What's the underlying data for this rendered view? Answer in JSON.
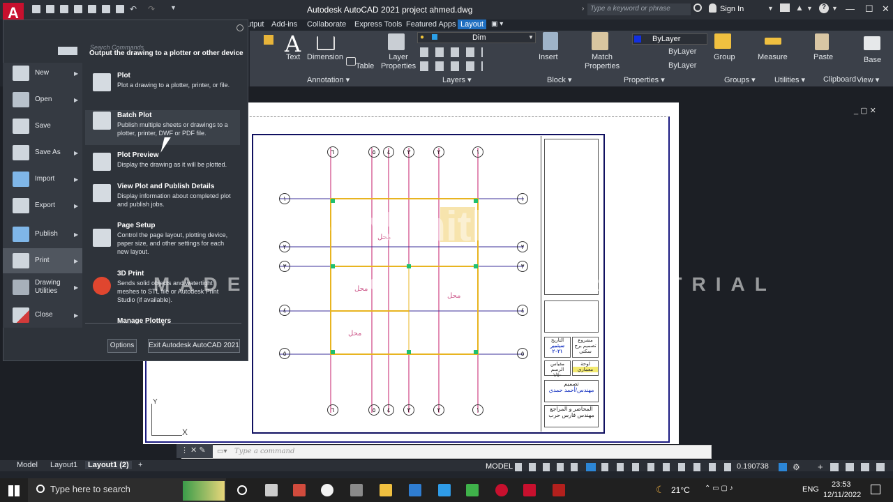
{
  "window": {
    "title": "Autodesk AutoCAD 2021   project ahmed.dwg",
    "search_placeholder": "Type a keyword or phrase",
    "sign_in": "Sign In"
  },
  "ribbon_tabs": [
    {
      "label": "utput"
    },
    {
      "label": "Add-ins"
    },
    {
      "label": "Collaborate"
    },
    {
      "label": "Express Tools"
    },
    {
      "label": "Featured Apps"
    },
    {
      "label": "Layout"
    }
  ],
  "ribbon": {
    "text": "Text",
    "dimension": "Dimension",
    "table": "Table",
    "layer_properties": "Layer Properties",
    "layer_current": "Dim",
    "insert": "Insert",
    "match_properties": "Match Properties",
    "bylayer_color": "ByLayer",
    "bylayer_linetype": "ByLayer",
    "bylayer_lineweight": "ByLayer",
    "group": "Group",
    "measure": "Measure",
    "paste": "Paste",
    "base": "Base",
    "panels": [
      "Annotation",
      "Layers",
      "Block",
      "Properties",
      "Groups",
      "Utilities",
      "Clipboard",
      "View"
    ]
  },
  "app_menu": {
    "search_placeholder": "Search Commands",
    "header": "Output the drawing to a plotter or other device",
    "left_items": [
      {
        "label": "New"
      },
      {
        "label": "Open"
      },
      {
        "label": "Save"
      },
      {
        "label": "Save As"
      },
      {
        "label": "Import"
      },
      {
        "label": "Export"
      },
      {
        "label": "Publish"
      },
      {
        "label": "Print"
      },
      {
        "label": "Drawing Utilities"
      },
      {
        "label": "Close"
      }
    ],
    "entries": [
      {
        "title": "Plot",
        "desc": "Plot a drawing to a plotter, printer, or file."
      },
      {
        "title": "Batch Plot",
        "desc": "Publish multiple sheets or drawings to a plotter, printer, DWF or PDF file."
      },
      {
        "title": "Plot Preview",
        "desc": "Display the drawing as it will be plotted."
      },
      {
        "title": "View Plot and Publish Details",
        "desc": "Display information about completed plot and publish jobs."
      },
      {
        "title": "Page Setup",
        "desc": "Control the page layout, plotting device, paper size, and other settings for each new layout."
      },
      {
        "title": "3D Print",
        "desc": "Sends solid objects and watertight meshes to STL file or Autodesk Print Studio (if available)."
      },
      {
        "title": "Manage Plotters",
        "desc": ""
      }
    ],
    "options_button": "Options",
    "exit_button": "Exit Autodesk AutoCAD 2021"
  },
  "drawing": {
    "grid_top": [
      "٦",
      "٥",
      "٤",
      "٣",
      "٢",
      "١"
    ],
    "grid_side": [
      "١",
      "٢",
      "٣",
      "٤",
      "٥"
    ],
    "room_labels": [
      "محل",
      "محل",
      "محل",
      "محل"
    ],
    "title_block": {
      "date_label": "التاريخ",
      "date_value": "سبتمبر ٢٠٢١",
      "project_label": "مشروع",
      "project_value": "تصميم برج سكني",
      "scale_label": "مقياس الرسم",
      "scale_value": "١/٥٠",
      "sheet_label": "لوحة",
      "sheet_value": "معماري",
      "design_label": "تصميم",
      "design_value": "مهندس/أحمد حمدي",
      "checker_label": "المحاضر و المراجع",
      "checker_value": "مهندس فارس حرب"
    },
    "ucs_x": "X",
    "ucs_y": "Y"
  },
  "command_line": {
    "placeholder": "Type a command"
  },
  "layout_tabs": [
    {
      "label": "Model"
    },
    {
      "label": "Layout1"
    },
    {
      "label": "Layout1 (2)"
    },
    {
      "label": "+"
    }
  ],
  "status_bar": {
    "model": "MODEL",
    "scale": "0.190738"
  },
  "taskbar": {
    "search": "Type here to search",
    "weather": "21°C",
    "lang": "ENG",
    "time": "23:53",
    "date": "12/11/2022"
  },
  "watermark": {
    "brand": "TechSmith",
    "trial": "MADE WITH CAMTASIA FREE TRIAL"
  }
}
